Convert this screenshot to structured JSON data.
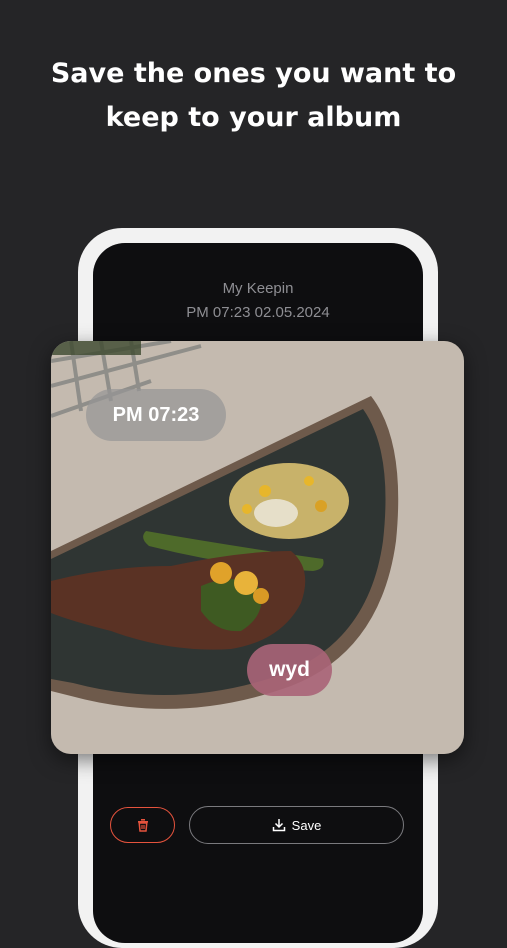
{
  "headline": {
    "line1": "Save the ones you want to",
    "line2": "keep to your album"
  },
  "app": {
    "title": "My Keepin",
    "timestamp": "PM 07:23 02.05.2024"
  },
  "photo": {
    "time_label": "PM 07:23",
    "caption": "wyd"
  },
  "actions": {
    "delete_icon": "trash-icon",
    "save_icon": "download-icon",
    "save_label": "Save"
  },
  "colors": {
    "background": "#252527",
    "accent_delete": "#e5533d",
    "caption_pill": "#aa6478"
  }
}
